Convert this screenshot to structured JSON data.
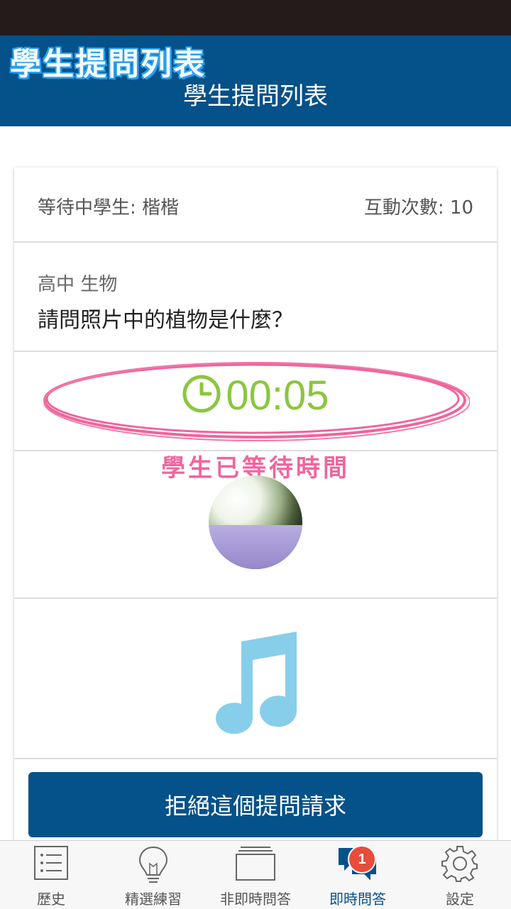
{
  "header": {
    "annotation_title": "學生提問列表",
    "title": "學生提問列表"
  },
  "card": {
    "waiting_student": "等待中學生: 楷楷",
    "interaction_count": "互動次數: 10",
    "subject": "高中 生物",
    "question": "請問照片中的植物是什麼？",
    "timer": "00:05",
    "wait_annotation": "學生已等待時間"
  },
  "actions": {
    "reject_label": "拒絕這個提問請求"
  },
  "tabs": [
    {
      "label": "歷史",
      "icon": "list-icon"
    },
    {
      "label": "精選練習",
      "icon": "lightbulb-icon"
    },
    {
      "label": "非即時問答",
      "icon": "stack-icon"
    },
    {
      "label": "即時問答",
      "icon": "chat-icon",
      "badge": "1",
      "active": true
    },
    {
      "label": "設定",
      "icon": "gear-icon"
    }
  ],
  "colors": {
    "primary": "#055189",
    "timer": "#8cc63f",
    "annotation": "#f0659d",
    "badge": "#e74c3c",
    "music": "#87ceeb"
  }
}
